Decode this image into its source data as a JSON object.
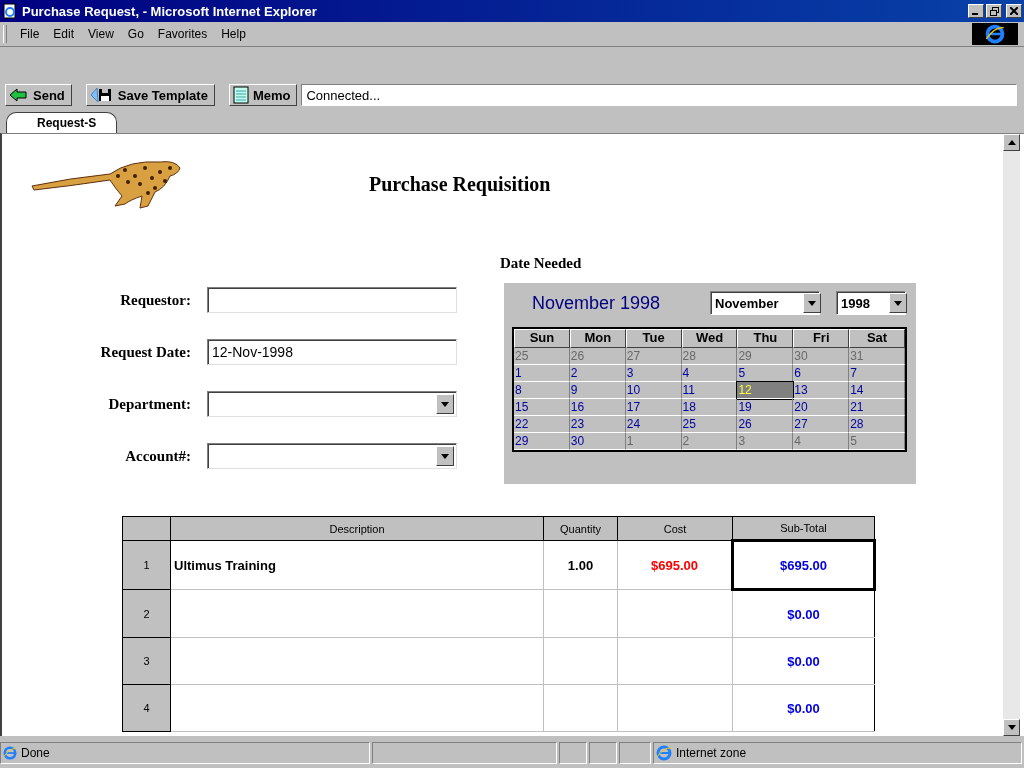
{
  "window": {
    "title": "Purchase Request, - Microsoft Internet Explorer"
  },
  "menu": [
    {
      "label": "File"
    },
    {
      "label": "Edit"
    },
    {
      "label": "View"
    },
    {
      "label": "Go"
    },
    {
      "label": "Favorites"
    },
    {
      "label": "Help"
    }
  ],
  "toolbar": {
    "buttons": [
      {
        "label": "Send",
        "kind": "send"
      },
      {
        "label": "Save Template",
        "kind": "save"
      },
      {
        "label": "Memo",
        "kind": "memo"
      }
    ],
    "status_field": {
      "value": "Connected..."
    }
  },
  "tabs": [
    {
      "label": "Request-S",
      "selected": true
    }
  ],
  "page": {
    "title": "Purchase Requisition",
    "date_needed_label": "Date Needed",
    "fields": [
      {
        "label": "Requestor:",
        "kind": "text"
      },
      {
        "label": "Request Date:",
        "kind": "text",
        "value": "12-Nov-1998"
      },
      {
        "label": "Department:",
        "kind": "dropdown"
      },
      {
        "label": "Account#:",
        "kind": "dropdown"
      }
    ]
  },
  "calendar": {
    "heading": "November 1998",
    "month_select": "November",
    "year_select": "1998",
    "weekdays": [
      "Sun",
      "Mon",
      "Tue",
      "Wed",
      "Thu",
      "Fri",
      "Sat"
    ],
    "weeks": [
      [
        {
          "day": "25",
          "muted": true,
          "selected": false
        },
        {
          "day": "26",
          "muted": true,
          "selected": false
        },
        {
          "day": "27",
          "muted": true,
          "selected": false
        },
        {
          "day": "28",
          "muted": true,
          "selected": false
        },
        {
          "day": "29",
          "muted": true,
          "selected": false
        },
        {
          "day": "30",
          "muted": true,
          "selected": false
        },
        {
          "day": "31",
          "muted": true,
          "selected": false
        }
      ],
      [
        {
          "day": "1",
          "muted": false,
          "selected": false
        },
        {
          "day": "2",
          "muted": false,
          "selected": false
        },
        {
          "day": "3",
          "muted": false,
          "selected": false
        },
        {
          "day": "4",
          "muted": false,
          "selected": false
        },
        {
          "day": "5",
          "muted": false,
          "selected": false
        },
        {
          "day": "6",
          "muted": false,
          "selected": false
        },
        {
          "day": "7",
          "muted": false,
          "selected": false
        }
      ],
      [
        {
          "day": "8",
          "muted": false,
          "selected": false
        },
        {
          "day": "9",
          "muted": false,
          "selected": false
        },
        {
          "day": "10",
          "muted": false,
          "selected": false
        },
        {
          "day": "11",
          "muted": false,
          "selected": false
        },
        {
          "day": "12",
          "muted": false,
          "selected": true
        },
        {
          "day": "13",
          "muted": false,
          "selected": false
        },
        {
          "day": "14",
          "muted": false,
          "selected": false
        }
      ],
      [
        {
          "day": "15",
          "muted": false,
          "selected": false
        },
        {
          "day": "16",
          "muted": false,
          "selected": false
        },
        {
          "day": "17",
          "muted": false,
          "selected": false
        },
        {
          "day": "18",
          "muted": false,
          "selected": false
        },
        {
          "day": "19",
          "muted": false,
          "selected": false
        },
        {
          "day": "20",
          "muted": false,
          "selected": false
        },
        {
          "day": "21",
          "muted": false,
          "selected": false
        }
      ],
      [
        {
          "day": "22",
          "muted": false,
          "selected": false
        },
        {
          "day": "23",
          "muted": false,
          "selected": false
        },
        {
          "day": "24",
          "muted": false,
          "selected": false
        },
        {
          "day": "25",
          "muted": false,
          "selected": false
        },
        {
          "day": "26",
          "muted": false,
          "selected": false
        },
        {
          "day": "27",
          "muted": false,
          "selected": false
        },
        {
          "day": "28",
          "muted": false,
          "selected": false
        }
      ],
      [
        {
          "day": "29",
          "muted": false,
          "selected": false
        },
        {
          "day": "30",
          "muted": false,
          "selected": false
        },
        {
          "day": "1",
          "muted": true,
          "selected": false
        },
        {
          "day": "2",
          "muted": true,
          "selected": false
        },
        {
          "day": "3",
          "muted": true,
          "selected": false
        },
        {
          "day": "4",
          "muted": true,
          "selected": false
        },
        {
          "day": "5",
          "muted": true,
          "selected": false
        }
      ]
    ]
  },
  "table": {
    "columns": [
      "Description",
      "Quantity",
      "Cost",
      "Sub-Total"
    ],
    "rows": [
      {
        "number": "1",
        "description": "Ultimus Training",
        "quantity": "1.00",
        "cost": "$695.00",
        "subtotal": "$695.00",
        "selected": true
      },
      {
        "number": "2",
        "subtotal": "$0.00",
        "selected": false
      },
      {
        "number": "3",
        "subtotal": "$0.00",
        "selected": false
      },
      {
        "number": "4",
        "subtotal": "$0.00",
        "selected": false
      }
    ]
  },
  "status_bar": {
    "text": "Done",
    "zone": "Internet zone"
  }
}
